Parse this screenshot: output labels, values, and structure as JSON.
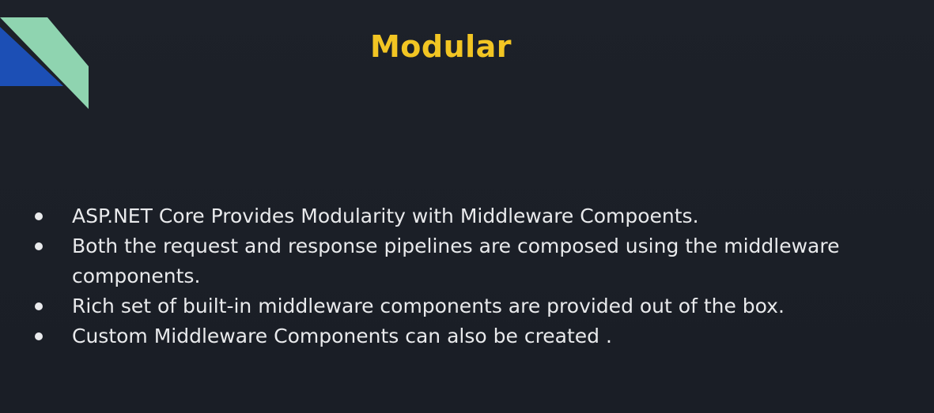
{
  "slide": {
    "title": "Modular",
    "bullets": [
      "ASP.NET Core Provides Modularity with Middleware Compoents.",
      "Both the request and response pipelines are composed using the middleware components.",
      "Rich set of built-in middleware components are provided out of the box.",
      "Custom Middleware Components can also be created ."
    ]
  },
  "colors": {
    "background": "#1b1f27",
    "title": "#f2c523",
    "text": "#e9eaec",
    "accent_green": "#8fd4b0",
    "accent_blue": "#1c4fb5"
  }
}
